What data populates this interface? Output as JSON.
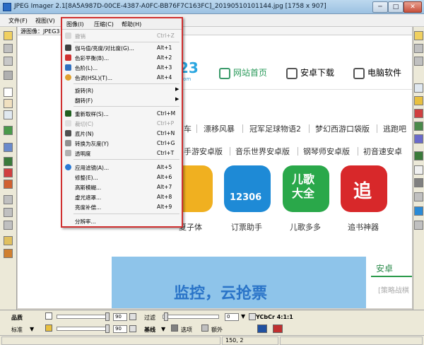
{
  "window": {
    "title": "JPEG Imager 2.1[8A5A987D-00CE-4387-A0FC-BB76F7C163FC]_20190510101144.jpg [1758 x 907]",
    "min": "─",
    "max": "□",
    "close": "✕"
  },
  "menubar": {
    "file": "文件(F)",
    "view": "视图(V)"
  },
  "doc": {
    "source_label": "源图像：JPEG3"
  },
  "dropdown": {
    "header": [
      "图像(I)",
      "压缩(C)",
      "帮助(H)"
    ],
    "items": [
      {
        "label": "撤销",
        "shortcut": "Ctrl+Z",
        "disabled": true
      },
      {
        "label": "伽马值/亮度/对比度(G)...",
        "shortcut": "Alt+1"
      },
      {
        "label": "色彩平衡(B)...",
        "shortcut": "Alt+2"
      },
      {
        "label": "色阶(L)...",
        "shortcut": "Alt+3"
      },
      {
        "label": "色调(HSL)(T)...",
        "shortcut": "Alt+4"
      },
      {
        "label": "旋转(R)",
        "arrow": "▶"
      },
      {
        "label": "翻转(F)",
        "arrow": "▶"
      },
      {
        "label": "重新取样(S)...",
        "shortcut": "Ctrl+M"
      },
      {
        "label": "裁切(C)",
        "shortcut": "Ctrl+P",
        "disabled": true
      },
      {
        "label": "底片(N)",
        "shortcut": "Ctrl+N"
      },
      {
        "label": "转换为灰度(Y)",
        "shortcut": "Ctrl+G"
      },
      {
        "label": "透明度",
        "shortcut": "Ctrl+T"
      },
      {
        "label": "应用滤镜(A)...",
        "shortcut": "Alt+5"
      },
      {
        "label": "修整(E)...",
        "shortcut": "Alt+6"
      },
      {
        "label": "高斯模糊...",
        "shortcut": "Alt+7"
      },
      {
        "label": "虚光遮罩...",
        "shortcut": "Alt+8"
      },
      {
        "label": "亮度补偿...",
        "shortcut": "Alt+9"
      },
      {
        "label": "分辨率..."
      }
    ]
  },
  "webpage": {
    "logo_tail": "23",
    "logo_sub": ".com",
    "nav": [
      "网站首页",
      "安卓下载",
      "电脑软件"
    ],
    "links_row1": [
      "车",
      "漂移风暴",
      "冠军足球物语2",
      "梦幻西游口袋版",
      "逃跑吧"
    ],
    "links_row2": [
      "手游安卓版",
      "音乐世界安卓版",
      "钢琴师安卓版",
      "初音速安卓"
    ],
    "apps": [
      {
        "name": "夏子体",
        "tile_text": "",
        "color": "#f0b020"
      },
      {
        "name": "订票助手",
        "tile_text": "12306",
        "color": "#1e8ad6"
      },
      {
        "name": "儿歌多多",
        "tile_text": "儿歌\n大全",
        "color": "#2aa84a"
      },
      {
        "name": "追书神器",
        "tile_text": "追",
        "color": "#d8282a"
      }
    ],
    "banner_text": "监控，云抢票",
    "side_title": "安卓",
    "side_sub": "[策略战棋"
  },
  "bottom": {
    "row1_label": "品质",
    "row1_val": "90",
    "row2_label": "标准",
    "row2_val": "90",
    "filter_label": "过滤",
    "filter_val": "0",
    "ycbcr": "YCbCr 4:1:1",
    "baseline": "基线",
    "options": "选项",
    "extra": "额外",
    "arrow": "▼"
  },
  "status": {
    "coords": "150, 2"
  }
}
